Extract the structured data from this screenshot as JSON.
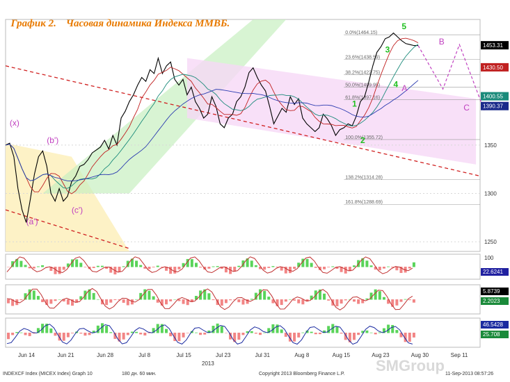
{
  "title": {
    "label": "График 2.",
    "text": "Часовая динамика Индекса ММВБ."
  },
  "colors": {
    "price": "#000000",
    "accent": "#e87a00",
    "elliott": "#c040c0",
    "trend": "#d02020",
    "green": "#21c021",
    "channel_green": "#c8f0c0",
    "channel_pink": "#f6d8f6",
    "channel_yellow": "#fdf1c0"
  },
  "chart_data": {
    "type": "line",
    "title": "",
    "xlabel": "2013",
    "ylabel": "",
    "ylim": [
      1240,
      1480
    ],
    "y_ticks": [
      1250,
      1300,
      1350
    ],
    "x_ticks": [
      "Jun 14",
      "Jun 21",
      "Jun 28",
      "Jul 8",
      "Jul 15",
      "Jul 23",
      "Jul 31",
      "Aug 8",
      "Aug 15",
      "Aug 23",
      "Aug 30",
      "Sep 11"
    ],
    "series": [
      {
        "x": [
          0,
          1,
          2,
          3,
          4,
          5,
          6,
          7,
          8,
          9,
          10,
          11,
          12,
          13,
          14,
          15,
          16,
          17,
          18,
          19,
          20,
          21,
          22,
          23,
          24,
          25,
          26,
          27,
          28,
          29,
          30,
          31,
          32,
          33,
          34,
          35,
          36,
          37,
          38,
          39,
          40,
          41,
          42,
          43,
          44,
          45,
          46,
          47,
          48,
          49,
          50,
          51,
          52,
          53,
          54,
          55,
          56,
          57,
          58,
          59,
          60,
          61,
          62,
          63,
          64,
          65,
          66,
          67,
          68,
          69,
          70,
          71,
          72,
          73,
          74,
          75,
          76,
          77,
          78,
          79,
          80,
          81,
          82,
          83,
          84,
          85,
          86,
          87,
          88,
          89,
          90,
          91,
          92,
          93,
          94,
          95,
          96,
          97,
          98,
          99,
          100
        ],
        "values": [
          1350,
          1352,
          1338,
          1305,
          1283,
          1270,
          1294,
          1320,
          1338,
          1344,
          1328,
          1300,
          1292,
          1305,
          1292,
          1297,
          1312,
          1318,
          1328,
          1330,
          1335,
          1342,
          1345,
          1348,
          1355,
          1346,
          1360,
          1350,
          1378,
          1385,
          1395,
          1402,
          1412,
          1420,
          1416,
          1428,
          1424,
          1440,
          1424,
          1432,
          1436,
          1418,
          1412,
          1418,
          1402,
          1410,
          1395,
          1388,
          1378,
          1382,
          1400,
          1390,
          1372,
          1368,
          1378,
          1382,
          1395,
          1400,
          1410,
          1425,
          1430,
          1420,
          1412,
          1406,
          1390,
          1372,
          1380,
          1388,
          1384,
          1400,
          1392,
          1398,
          1378,
          1372,
          1368,
          1364,
          1368,
          1382,
          1377,
          1370,
          1360,
          1366,
          1368,
          1372,
          1370,
          1380,
          1395,
          1400,
          1415,
          1432,
          1446,
          1452,
          1460,
          1462,
          1466,
          1462,
          1458,
          1455,
          1454,
          1453,
          1453
        ]
      }
    ],
    "price_tags": [
      {
        "value": 1453.31,
        "label": "1453.31",
        "color": "#000000"
      },
      {
        "value": 1430.5,
        "label": "1430.50",
        "color": "#c02020"
      },
      {
        "value": 1400.55,
        "label": "1400.55",
        "color": "#1a8a7a"
      },
      {
        "value": 1390.37,
        "label": "1390.37",
        "color": "#1a2a8a"
      }
    ],
    "fib_levels": [
      {
        "value": 1464.15,
        "label": "0.0%(1464.15)"
      },
      {
        "value": 1438.59,
        "label": "23.6%(1438.59)"
      },
      {
        "value": 1422.75,
        "label": "38.2%(1422.75)"
      },
      {
        "value": 1409.95,
        "label": "50.0%(1409.95)"
      },
      {
        "value": 1397.16,
        "label": "61.8%(1397.16)"
      },
      {
        "value": 1355.72,
        "label": "100.0%(1355.72)"
      },
      {
        "value": 1314.28,
        "label": "138.2%(1314.28)"
      },
      {
        "value": 1288.69,
        "label": "161.8%(1288.69)"
      }
    ],
    "wave_labels_purple": [
      {
        "x": 1,
        "y": 1370,
        "label": "(x)"
      },
      {
        "x": 5,
        "y": 1268,
        "label": "(a')"
      },
      {
        "x": 10,
        "y": 1352,
        "label": "(b')"
      },
      {
        "x": 16,
        "y": 1280,
        "label": "(c')"
      },
      {
        "x": 96,
        "y": 1406,
        "label": "A"
      },
      {
        "x": 105,
        "y": 1454,
        "label": "B"
      },
      {
        "x": 111,
        "y": 1386,
        "label": "C"
      }
    ],
    "wave_labels_green": [
      {
        "x": 84,
        "y": 1390,
        "label": "1"
      },
      {
        "x": 86,
        "y": 1352,
        "label": "2"
      },
      {
        "x": 92,
        "y": 1446,
        "label": "3"
      },
      {
        "x": 94,
        "y": 1410,
        "label": "4"
      },
      {
        "x": 96,
        "y": 1470,
        "label": "5"
      }
    ],
    "indicator_panels": [
      {
        "name": "panel-1",
        "ticks": [
          "100"
        ],
        "readouts": [
          {
            "label": "22.6241",
            "color": "#2020a0"
          }
        ]
      },
      {
        "name": "panel-2",
        "ticks": [],
        "readouts": [
          {
            "label": "5.8739",
            "color": "#000000"
          },
          {
            "label": "2.2023",
            "color": "#1a8a3a"
          }
        ]
      },
      {
        "name": "panel-3",
        "ticks": [],
        "readouts": [
          {
            "label": "46.5428",
            "color": "#1a2aa0"
          },
          {
            "label": "25.708",
            "color": "#1a8a3a"
          }
        ]
      }
    ]
  },
  "footer": {
    "left": "INDEXCF Index (MICEX Index) Graph 10",
    "middle": "180 дн. 60 мин.",
    "copyright": "Copyright 2013 Bloomberg Finance L.P.",
    "date": "11-Sep-2013 08:57:26",
    "watermark": "SMGroup"
  }
}
